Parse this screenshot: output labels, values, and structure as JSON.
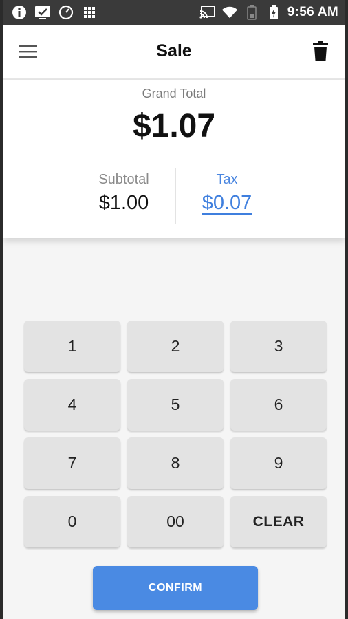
{
  "status_bar": {
    "time": "9:56 AM",
    "left_icons": [
      "info-icon",
      "check-box-icon",
      "clock-icon",
      "grid-dots-icon"
    ],
    "right_icons": [
      "cast-icon",
      "wifi-icon",
      "battery-empty-icon",
      "battery-charging-icon"
    ]
  },
  "app_bar": {
    "title": "Sale",
    "menu_icon": "hamburger-menu-icon",
    "delete_icon": "trash-icon"
  },
  "totals": {
    "grand_total_label": "Grand Total",
    "grand_total_value": "$1.07",
    "subtotal_label": "Subtotal",
    "subtotal_value": "$1.00",
    "tax_label": "Tax",
    "tax_value": "$0.07"
  },
  "keypad": {
    "keys": [
      "1",
      "2",
      "3",
      "4",
      "5",
      "6",
      "7",
      "8",
      "9",
      "0",
      "00",
      "CLEAR"
    ]
  },
  "confirm_label": "CONFIRM",
  "colors": {
    "accent": "#4a8ae3",
    "tax_link": "#3f7fde",
    "key_bg": "#e3e3e3",
    "status_bar": "#3a3a3a"
  }
}
